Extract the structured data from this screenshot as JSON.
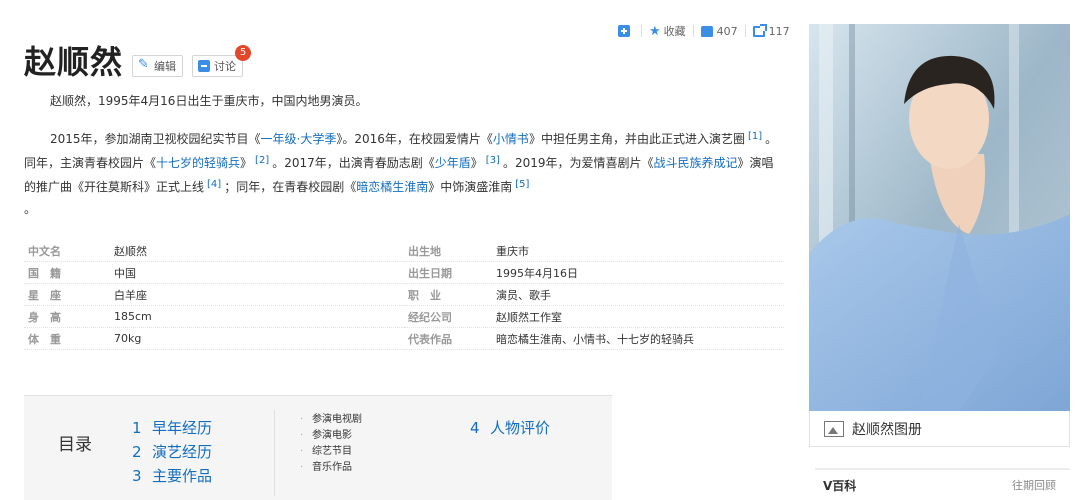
{
  "toolbar": {
    "favorite_label": "收藏",
    "likes": "407",
    "shares": "117"
  },
  "title": "赵顺然",
  "edit_label": "编辑",
  "discuss_label": "讨论",
  "discuss_badge": "5",
  "summary": {
    "p1": "赵顺然，1995年4月16日出生于重庆市，中国内地男演员。",
    "p2": {
      "t1": "2015年，参加湖南卫视校园纪实节目《",
      "l1": "一年级·大学季",
      "t2": "》。2016年，在校园爱情片《",
      "l2": "小情书",
      "t3": "》中担任男主角，并由此正式进入演艺圈",
      "r1": "[1]",
      "t4": "。同年，主演青春校园片《",
      "l3": "十七岁的轻骑兵",
      "t5": "》",
      "r2": "[2]",
      "t6": "。2017年，出演青春励志剧《",
      "l4": "少年盾",
      "t7": "》",
      "r3": "[3]",
      "t8": "。2019年，为爱情喜剧片《",
      "l5": "战斗民族养成记",
      "t9": "》演唱的推广曲《开往莫斯科》正式上线",
      "r4": "[4]",
      "t10": "；同年，在青春校园剧《",
      "l6": "暗恋橘生淮南",
      "t11": "》中饰演盛淮南",
      "r5": "[5]",
      "t12": "。"
    }
  },
  "info_left": [
    {
      "k": "中文名",
      "v": "赵顺然"
    },
    {
      "k": "国　籍",
      "v": "中国"
    },
    {
      "k": "星　座",
      "v": "白羊座"
    },
    {
      "k": "身　高",
      "v": "185cm"
    },
    {
      "k": "体　重",
      "v": "70kg"
    }
  ],
  "info_right": [
    {
      "k": "出生地",
      "v": "重庆市"
    },
    {
      "k": "出生日期",
      "v": "1995年4月16日"
    },
    {
      "k": "职　业",
      "v": "演员、歌手"
    },
    {
      "k": "经纪公司",
      "v": "赵顺然工作室"
    },
    {
      "k": "代表作品",
      "v": "暗恋橘生淮南、小情书、十七岁的轻骑兵"
    }
  ],
  "catalog": {
    "label": "目录",
    "items": [
      {
        "n": "1",
        "t": "早年经历"
      },
      {
        "n": "2",
        "t": "演艺经历"
      },
      {
        "n": "3",
        "t": "主要作品"
      },
      {
        "n": "4",
        "t": "人物评价"
      }
    ],
    "subitems": [
      "参演电视剧",
      "参演电影",
      "综艺节目",
      "音乐作品"
    ]
  },
  "album_label": "赵顺然图册",
  "vbaike": {
    "title": "V百科",
    "more": "往期回顾"
  }
}
